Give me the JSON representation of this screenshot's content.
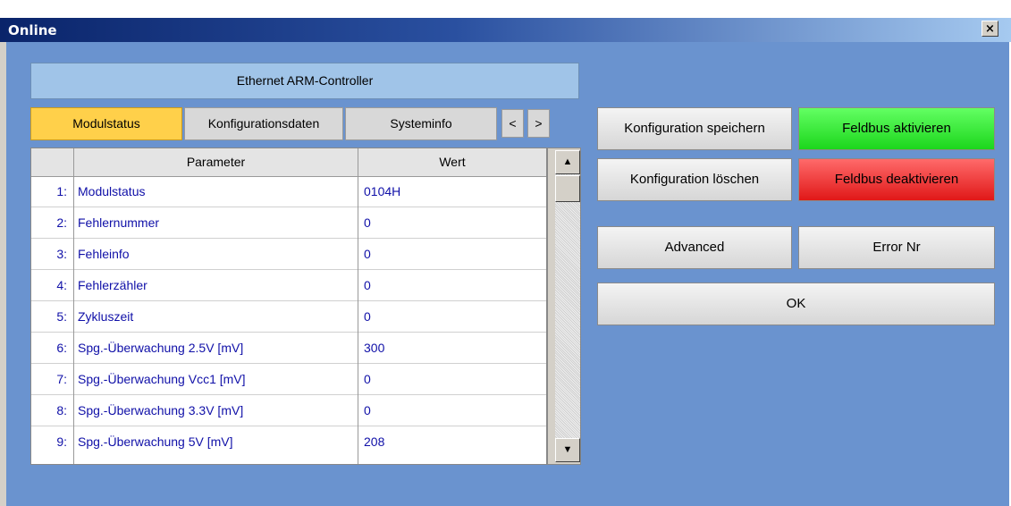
{
  "window": {
    "title": "Online",
    "close_symbol": "×"
  },
  "device": {
    "name": "Ethernet ARM-Controller"
  },
  "tabs": [
    {
      "label": "Modulstatus",
      "active": true
    },
    {
      "label": "Konfigurationsdaten",
      "active": false
    },
    {
      "label": "Systeminfo",
      "active": false
    }
  ],
  "tab_nav": {
    "prev": "<",
    "next": ">"
  },
  "table": {
    "headers": {
      "parameter": "Parameter",
      "value": "Wert"
    },
    "rows": [
      {
        "num": "1:",
        "param": "Modulstatus",
        "value": "0104H"
      },
      {
        "num": "2:",
        "param": "Fehlernummer",
        "value": "0"
      },
      {
        "num": "3:",
        "param": "Fehleinfo",
        "value": "0"
      },
      {
        "num": "4:",
        "param": "Fehlerzähler",
        "value": "0"
      },
      {
        "num": "5:",
        "param": "Zykluszeit",
        "value": "0"
      },
      {
        "num": "6:",
        "param": "Spg.-Überwachung 2.5V [mV]",
        "value": "300"
      },
      {
        "num": "7:",
        "param": "Spg.-Überwachung Vcc1 [mV]",
        "value": "0"
      },
      {
        "num": "8:",
        "param": "Spg.-Überwachung 3.3V [mV]",
        "value": "0"
      },
      {
        "num": "9:",
        "param": "Spg.-Überwachung 5V [mV]",
        "value": "208"
      }
    ]
  },
  "buttons": {
    "save_config": "Konfiguration speichern",
    "fieldbus_on": "Feldbus aktivieren",
    "delete_config": "Konfiguration löschen",
    "fieldbus_off": "Feldbus deaktivieren",
    "advanced": "Advanced",
    "error_nr": "Error Nr",
    "ok": "OK"
  },
  "colors": {
    "title_gradient_start": "#0a246a",
    "client_bg": "#6a93cf",
    "active_tab": "#ffd04a",
    "activate_button": "#33ee33",
    "deactivate_button": "#ee2a2a",
    "table_text": "#1010a8"
  },
  "icons": {
    "close": "close-icon",
    "scroll_up": "arrow-up-icon",
    "scroll_down": "arrow-down-icon"
  }
}
